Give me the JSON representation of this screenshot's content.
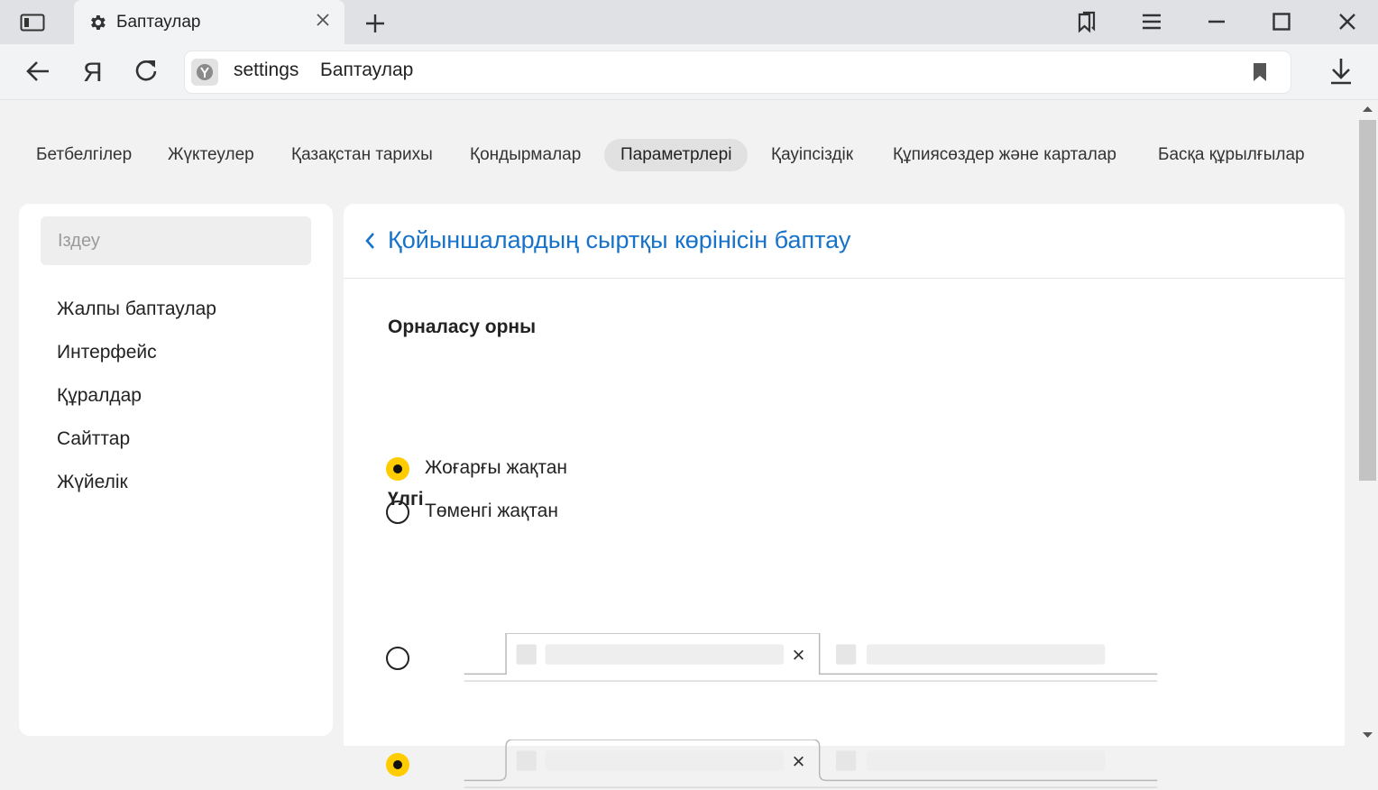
{
  "browser": {
    "tab": {
      "title": "Баптаулар",
      "icon": "gear-icon"
    },
    "address": {
      "url": "settings",
      "page_title": "Баптаулар"
    }
  },
  "top_nav": [
    {
      "label": "Бетбелгілер"
    },
    {
      "label": "Жүктеулер"
    },
    {
      "label": "Қазақстан тарихы"
    },
    {
      "label": "Қондырмалар"
    },
    {
      "label": "Параметрлері",
      "active": true
    },
    {
      "label": "Қауіпсіздік"
    },
    {
      "label": "Құпиясөздер және карталар"
    },
    {
      "label": "Басқа құрылғылар"
    }
  ],
  "sidebar": {
    "search_placeholder": "Іздеу",
    "items": [
      {
        "label": "Жалпы баптаулар"
      },
      {
        "label": "Интерфейс"
      },
      {
        "label": "Құралдар"
      },
      {
        "label": "Сайттар"
      },
      {
        "label": "Жүйелік"
      }
    ]
  },
  "panel": {
    "title": "Қойыншалардың сыртқы көрінісін баптау",
    "position": {
      "title": "Орналасу орны",
      "options": [
        {
          "label": "Жоғарғы жақтан",
          "checked": true
        },
        {
          "label": "Төменгі жақтан",
          "checked": false
        }
      ]
    },
    "style": {
      "title": "Үлгі",
      "options": [
        {
          "name": "square-tabs",
          "checked": false
        },
        {
          "name": "rounded-tabs",
          "checked": true
        }
      ]
    }
  },
  "colors": {
    "accent": "#ffcc00",
    "link": "#1772c9"
  }
}
